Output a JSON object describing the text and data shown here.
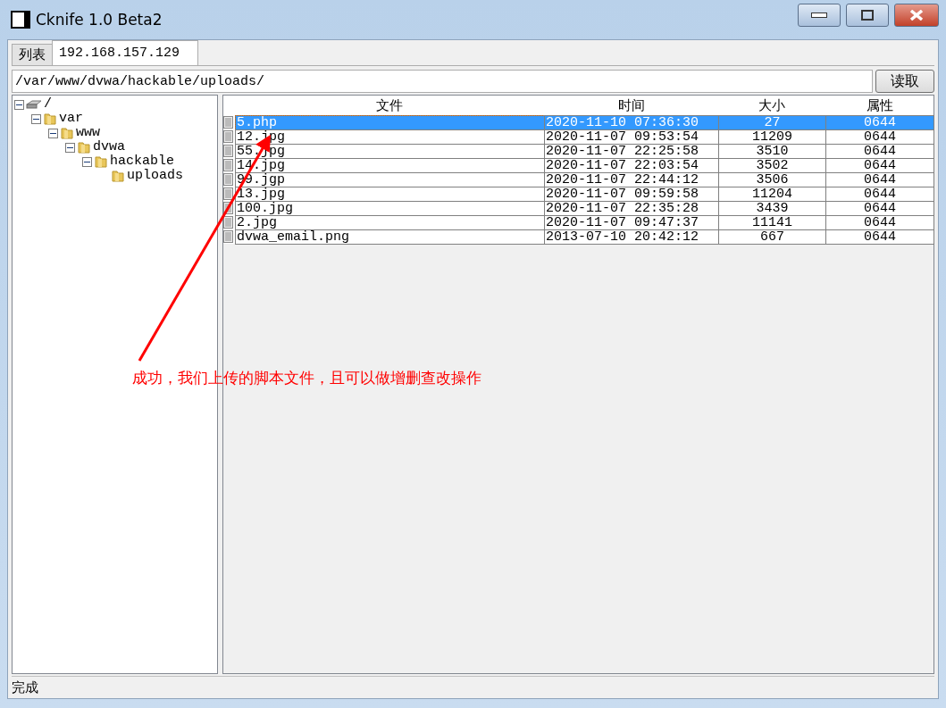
{
  "window": {
    "title": "Cknife 1.0 Beta2"
  },
  "tabs": [
    {
      "label": "列表",
      "selected": false
    },
    {
      "label": "192.168.157.129",
      "selected": true
    }
  ],
  "path_field": {
    "value": "/var/www/dvwa/hackable/uploads/"
  },
  "read_button": "读取",
  "tree": [
    {
      "label": "/",
      "kind": "drive",
      "expanded": true,
      "children": [
        {
          "label": "var",
          "kind": "folder",
          "expanded": true,
          "children": [
            {
              "label": "www",
              "kind": "folder",
              "expanded": true,
              "children": [
                {
                  "label": "dvwa",
                  "kind": "folder",
                  "expanded": true,
                  "children": [
                    {
                      "label": "hackable",
                      "kind": "folder",
                      "expanded": true,
                      "children": [
                        {
                          "label": "uploads",
                          "kind": "folder"
                        }
                      ]
                    }
                  ]
                }
              ]
            }
          ]
        }
      ]
    }
  ],
  "table": {
    "columns": [
      "文件",
      "时间",
      "大小",
      "属性"
    ],
    "rows": [
      {
        "cells": [
          "5.php",
          "2020-11-10 07:36:30",
          "27",
          "0644"
        ],
        "selected": true
      },
      {
        "cells": [
          "12.jpg",
          "2020-11-07 09:53:54",
          "11209",
          "0644"
        ],
        "selected": false
      },
      {
        "cells": [
          "55.jpg",
          "2020-11-07 22:25:58",
          "3510",
          "0644"
        ],
        "selected": false
      },
      {
        "cells": [
          "14.jpg",
          "2020-11-07 22:03:54",
          "3502",
          "0644"
        ],
        "selected": false
      },
      {
        "cells": [
          "99.jgp",
          "2020-11-07 22:44:12",
          "3506",
          "0644"
        ],
        "selected": false
      },
      {
        "cells": [
          "13.jpg",
          "2020-11-07 09:59:58",
          "11204",
          "0644"
        ],
        "selected": false
      },
      {
        "cells": [
          "100.jpg",
          "2020-11-07 22:35:28",
          "3439",
          "0644"
        ],
        "selected": false
      },
      {
        "cells": [
          "2.jpg",
          "2020-11-07 09:47:37",
          "11141",
          "0644"
        ],
        "selected": false
      },
      {
        "cells": [
          "dvwa_email.png",
          "2013-07-10 20:42:12",
          "667",
          "0644"
        ],
        "selected": false
      }
    ]
  },
  "annotation": "成功，我们上传的脚本文件，且可以做增删查改操作",
  "status_bar": "完成"
}
